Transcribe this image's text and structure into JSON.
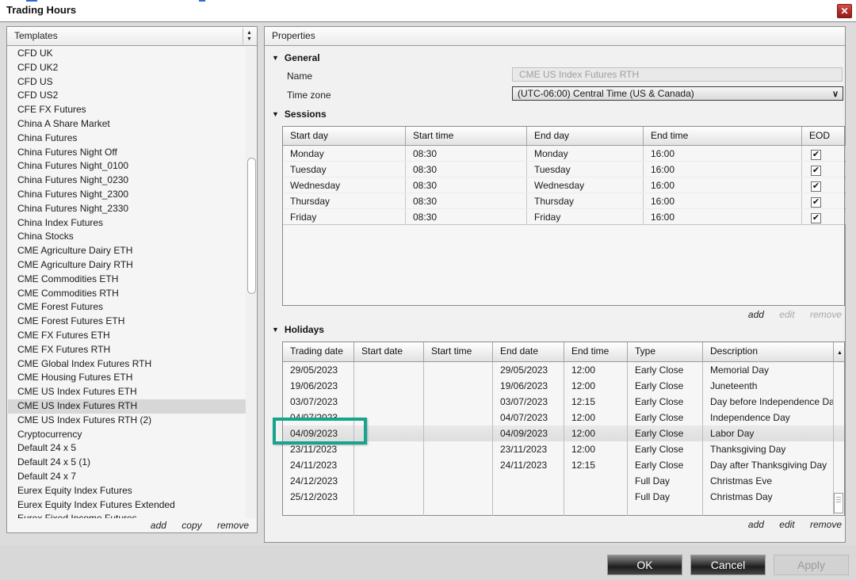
{
  "window": {
    "title": "Trading Hours",
    "close_glyph": "✕"
  },
  "templates": {
    "header": "Templates",
    "selected": "CME US Index Futures RTH",
    "items": [
      "CFD UK",
      "CFD UK2",
      "CFD US",
      "CFD US2",
      "CFE FX Futures",
      "China A Share Market",
      "China Futures",
      "China Futures Night Off",
      "China Futures Night_0100",
      "China Futures Night_0230",
      "China Futures Night_2300",
      "China Futures Night_2330",
      "China Index Futures",
      "China Stocks",
      "CME Agriculture Dairy ETH",
      "CME Agriculture Dairy RTH",
      "CME Commodities ETH",
      "CME Commodities RTH",
      "CME Forest Futures",
      "CME Forest Futures ETH",
      "CME FX Futures ETH",
      "CME FX Futures RTH",
      "CME Global Index Futures RTH",
      "CME Housing Futures ETH",
      "CME US Index Futures ETH",
      "CME US Index Futures RTH",
      "CME US Index Futures RTH (2)",
      "Cryptocurrency",
      "Default 24 x 5",
      "Default 24 x 5 (1)",
      "Default 24 x 7",
      "Eurex Equity Index Futures",
      "Eurex Equity Index Futures Extended",
      "Eurex Fixed Income Futures"
    ],
    "actions": {
      "add": "add",
      "copy": "copy",
      "remove": "remove"
    }
  },
  "properties": {
    "header": "Properties",
    "general": {
      "label": "General",
      "name_label": "Name",
      "name_value": "CME US Index Futures RTH",
      "timezone_label": "Time zone",
      "timezone_value": "(UTC-06:00) Central Time (US & Canada)",
      "chevron": "∨"
    },
    "sessions": {
      "label": "Sessions",
      "columns": [
        "Start day",
        "Start time",
        "End day",
        "End time",
        "EOD"
      ],
      "rows": [
        {
          "start_day": "Monday",
          "start_time": "08:30",
          "end_day": "Monday",
          "end_time": "16:00",
          "eod": true
        },
        {
          "start_day": "Tuesday",
          "start_time": "08:30",
          "end_day": "Tuesday",
          "end_time": "16:00",
          "eod": true
        },
        {
          "start_day": "Wednesday",
          "start_time": "08:30",
          "end_day": "Wednesday",
          "end_time": "16:00",
          "eod": true
        },
        {
          "start_day": "Thursday",
          "start_time": "08:30",
          "end_day": "Thursday",
          "end_time": "16:00",
          "eod": true
        },
        {
          "start_day": "Friday",
          "start_time": "08:30",
          "end_day": "Friday",
          "end_time": "16:00",
          "eod": true
        }
      ],
      "check_glyph": "✔",
      "actions": {
        "add": "add",
        "edit": "edit",
        "remove": "remove"
      },
      "actions_disabled": [
        "edit",
        "remove"
      ]
    },
    "holidays": {
      "label": "Holidays",
      "columns": [
        "Trading date",
        "Start date",
        "Start time",
        "End date",
        "End time",
        "Type",
        "Description"
      ],
      "rows": [
        {
          "trading_date": "29/05/2023",
          "start_date": "",
          "start_time": "",
          "end_date": "29/05/2023",
          "end_time": "12:00",
          "type": "Early Close",
          "description": "Memorial Day"
        },
        {
          "trading_date": "19/06/2023",
          "start_date": "",
          "start_time": "",
          "end_date": "19/06/2023",
          "end_time": "12:00",
          "type": "Early Close",
          "description": "Juneteenth"
        },
        {
          "trading_date": "03/07/2023",
          "start_date": "",
          "start_time": "",
          "end_date": "03/07/2023",
          "end_time": "12:15",
          "type": "Early Close",
          "description": "Day before Independence Day"
        },
        {
          "trading_date": "04/07/2023",
          "start_date": "",
          "start_time": "",
          "end_date": "04/07/2023",
          "end_time": "12:00",
          "type": "Early Close",
          "description": "Independence Day"
        },
        {
          "trading_date": "04/09/2023",
          "start_date": "",
          "start_time": "",
          "end_date": "04/09/2023",
          "end_time": "12:00",
          "type": "Early Close",
          "description": "Labor Day",
          "highlighted": true
        },
        {
          "trading_date": "23/11/2023",
          "start_date": "",
          "start_time": "",
          "end_date": "23/11/2023",
          "end_time": "12:00",
          "type": "Early Close",
          "description": "Thanksgiving Day"
        },
        {
          "trading_date": "24/11/2023",
          "start_date": "",
          "start_time": "",
          "end_date": "24/11/2023",
          "end_time": "12:15",
          "type": "Early Close",
          "description": "Day after Thanksgiving Day"
        },
        {
          "trading_date": "24/12/2023",
          "start_date": "",
          "start_time": "",
          "end_date": "",
          "end_time": "",
          "type": "Full Day",
          "description": "Christmas Eve"
        },
        {
          "trading_date": "25/12/2023",
          "start_date": "",
          "start_time": "",
          "end_date": "",
          "end_time": "",
          "type": "Full Day",
          "description": "Christmas Day"
        }
      ],
      "highlighted_trading_date": "04/09/2023",
      "actions": {
        "add": "add",
        "edit": "edit",
        "remove": "remove"
      }
    }
  },
  "footer": {
    "ok": "OK",
    "cancel": "Cancel",
    "apply": "Apply"
  },
  "colors": {
    "highlight_box": "#16A58C",
    "close_button": "#B02A26",
    "accent_row": "#E3E3E3"
  }
}
